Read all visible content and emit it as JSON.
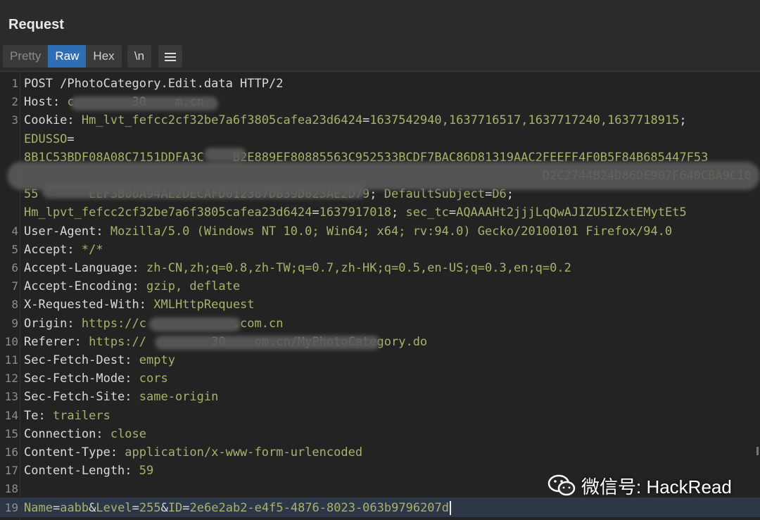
{
  "panel": {
    "title": "Request"
  },
  "toolbar": {
    "tabs": [
      "Pretty",
      "Raw",
      "Hex"
    ],
    "active_tab": "Raw",
    "newline_button": "\\n",
    "menu_icon": "menu-icon"
  },
  "lines": [
    {
      "n": "1",
      "parts": [
        [
          "k",
          "POST /PhotoCategory.Edit.data HTTP/2"
        ]
      ]
    },
    {
      "n": "2",
      "parts": [
        [
          "k",
          "Host: "
        ],
        [
          "v",
          "c        30    m.cn"
        ]
      ]
    },
    {
      "n": "3",
      "parts": [
        [
          "k",
          "Cookie: "
        ],
        [
          "v",
          "Hm_lvt_fefcc2cf32be7a6f3805cafea23d6424"
        ],
        [
          "k",
          "="
        ],
        [
          "v",
          "1637542940,1637716517,1637717240,1637718915"
        ],
        [
          "k",
          ";"
        ]
      ]
    },
    {
      "n": "",
      "parts": [
        [
          "v",
          "EDUSSO"
        ],
        [
          "k",
          "="
        ]
      ]
    },
    {
      "n": "",
      "parts": [
        [
          "v",
          "8B1C53BDF08A08C7151DDFA3C    B2E889EF80885563C952533BCDF7BAC86D81319AAC2FEEFF4F0B5F84B685447F53"
        ]
      ]
    },
    {
      "n": "",
      "parts": [
        [
          "v",
          "                                                                        D2C2744B24D86DE907F640CBA9C10"
        ]
      ]
    },
    {
      "n": "",
      "parts": [
        [
          "v",
          "55       EEF3B06A94AE2DECAFD012367DB39D623AE2D79"
        ],
        [
          "k",
          "; "
        ],
        [
          "v",
          "DefaultSubject"
        ],
        [
          "k",
          "="
        ],
        [
          "v",
          "D6"
        ],
        [
          "k",
          ";"
        ]
      ]
    },
    {
      "n": "",
      "parts": [
        [
          "v",
          "Hm_lpvt_fefcc2cf32be7a6f3805cafea23d6424"
        ],
        [
          "k",
          "="
        ],
        [
          "v",
          "1637917018"
        ],
        [
          "k",
          "; "
        ],
        [
          "v",
          "sec_tc"
        ],
        [
          "k",
          "="
        ],
        [
          "v",
          "AQAAAHt2jjjLqQwAJIZU5IZxtEMytEt5"
        ]
      ]
    },
    {
      "n": "4",
      "parts": [
        [
          "k",
          "User-Agent: "
        ],
        [
          "v",
          "Mozilla/5.0 (Windows NT 10.0; Win64; x64; rv:94.0) Gecko/20100101 Firefox/94.0"
        ]
      ]
    },
    {
      "n": "5",
      "parts": [
        [
          "k",
          "Accept: "
        ],
        [
          "v",
          "*/*"
        ]
      ]
    },
    {
      "n": "6",
      "parts": [
        [
          "k",
          "Accept-Language: "
        ],
        [
          "v",
          "zh-CN,zh;q=0.8,zh-TW;q=0.7,zh-HK;q=0.5,en-US;q=0.3,en;q=0.2"
        ]
      ]
    },
    {
      "n": "7",
      "parts": [
        [
          "k",
          "Accept-Encoding: "
        ],
        [
          "v",
          "gzip, deflate"
        ]
      ]
    },
    {
      "n": "8",
      "parts": [
        [
          "k",
          "X-Requested-With: "
        ],
        [
          "v",
          "XMLHttpRequest"
        ]
      ]
    },
    {
      "n": "9",
      "parts": [
        [
          "k",
          "Origin: "
        ],
        [
          "v",
          "https://c            .com.cn"
        ]
      ]
    },
    {
      "n": "10",
      "parts": [
        [
          "k",
          "Referer: "
        ],
        [
          "v",
          "https://         30    om.cn/MyPhotoCategory.do"
        ]
      ]
    },
    {
      "n": "11",
      "parts": [
        [
          "k",
          "Sec-Fetch-Dest: "
        ],
        [
          "v",
          "empty"
        ]
      ]
    },
    {
      "n": "12",
      "parts": [
        [
          "k",
          "Sec-Fetch-Mode: "
        ],
        [
          "v",
          "cors"
        ]
      ]
    },
    {
      "n": "13",
      "parts": [
        [
          "k",
          "Sec-Fetch-Site: "
        ],
        [
          "v",
          "same-origin"
        ]
      ]
    },
    {
      "n": "14",
      "parts": [
        [
          "k",
          "Te: "
        ],
        [
          "v",
          "trailers"
        ]
      ]
    },
    {
      "n": "15",
      "parts": [
        [
          "k",
          "Connection: "
        ],
        [
          "v",
          "close"
        ]
      ]
    },
    {
      "n": "16",
      "parts": [
        [
          "k",
          "Content-Type: "
        ],
        [
          "v",
          "application/x-www-form-urlencoded"
        ]
      ]
    },
    {
      "n": "17",
      "parts": [
        [
          "k",
          "Content-Length: "
        ],
        [
          "v",
          "59"
        ]
      ]
    },
    {
      "n": "18",
      "parts": []
    },
    {
      "n": "19",
      "parts": [
        [
          "v",
          "Name"
        ],
        [
          "k",
          "="
        ],
        [
          "v",
          "aabb"
        ],
        [
          "k",
          "&"
        ],
        [
          "v",
          "Level"
        ],
        [
          "k",
          "="
        ],
        [
          "v",
          "255"
        ],
        [
          "k",
          "&"
        ],
        [
          "v",
          "ID"
        ],
        [
          "k",
          "="
        ],
        [
          "v",
          "2e6e2ab2-e4f5-4876-8023-063b9796207d"
        ]
      ]
    }
  ],
  "watermark": {
    "text": "微信号: HackRead",
    "icon": "wechat-icon"
  },
  "colors": {
    "key": "#d9d9d9",
    "value": "#a7b36a",
    "active_tab": "#2f6db5",
    "background": "#232323"
  }
}
